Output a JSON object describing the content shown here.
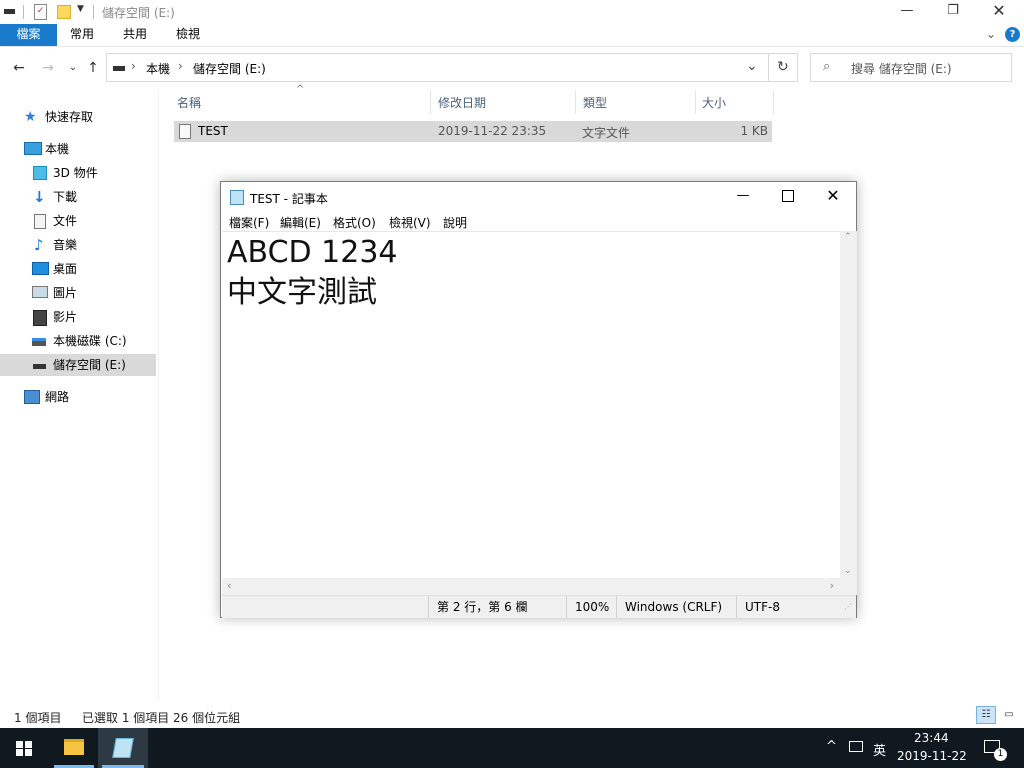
{
  "explorer": {
    "title": "儲存空間 (E:)",
    "ribbon_tabs": [
      "檔案",
      "常用",
      "共用",
      "檢視"
    ],
    "address": {
      "items": [
        "本機",
        "儲存空間 (E:)"
      ]
    },
    "search": {
      "placeholder": "搜尋 儲存空間 (E:)"
    },
    "nav": {
      "quick_access": "快速存取",
      "this_pc": "本機",
      "objects_3d": "3D 物件",
      "downloads": "下載",
      "documents": "文件",
      "music": "音樂",
      "desktop": "桌面",
      "pictures": "圖片",
      "videos": "影片",
      "drive_c": "本機磁碟 (C:)",
      "drive_e": "儲存空間 (E:)",
      "network": "網路"
    },
    "columns": {
      "name": "名稱",
      "modified": "修改日期",
      "type": "類型",
      "size": "大小"
    },
    "files": [
      {
        "name": "TEST",
        "modified": "2019-11-22 23:35",
        "type": "文字文件",
        "size": "1 KB"
      }
    ],
    "status": {
      "count": "1 個項目",
      "selected": "已選取 1 個項目",
      "bytes": "26 個位元組"
    }
  },
  "notepad": {
    "title": "TEST - 記事本",
    "menu": [
      "檔案(F)",
      "編輯(E)",
      "格式(O)",
      "檢視(V)",
      "說明"
    ],
    "content_line1": "ABCD 1234",
    "content_line2": "中文字測試",
    "status": {
      "position": "第 2 行，第 6 欄",
      "zoom": "100%",
      "eol": "Windows (CRLF)",
      "encoding": "UTF-8"
    }
  },
  "taskbar": {
    "ime": "英",
    "time": "23:44",
    "date": "2019-11-22",
    "notification_count": "1"
  },
  "colors": {
    "accent": "#1979ca",
    "taskbar": "#101820",
    "selection": "#d9d9d9"
  }
}
